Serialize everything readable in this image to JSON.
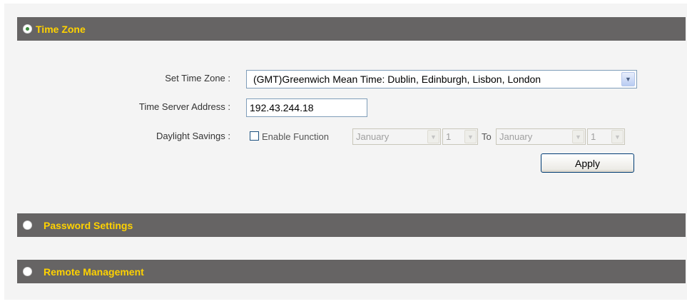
{
  "sections": {
    "time_zone": {
      "title": "Time Zone",
      "expanded": true
    },
    "password_settings": {
      "title": "Password Settings",
      "expanded": false
    },
    "remote_management": {
      "title": "Remote Management",
      "expanded": false
    }
  },
  "form": {
    "time_zone_label": "Set Time Zone :",
    "time_zone_value": "(GMT)Greenwich Mean Time: Dublin, Edinburgh, Lisbon, London",
    "time_server_label": "Time Server Address :",
    "time_server_value": "192.43.244.18",
    "daylight_label": "Daylight Savings :",
    "enable_function_label": "Enable Function",
    "enable_function_checked": false,
    "start_month": "January",
    "start_day": "1",
    "to_label": "To",
    "end_month": "January",
    "end_day": "1",
    "apply_label": "Apply"
  },
  "colors": {
    "header_bg": "#666464",
    "header_text": "#ffd200",
    "panel_bg": "#f4f4f4"
  },
  "icons": {
    "section_expanded": "radio-selected-icon",
    "section_collapsed": "radio-unselected-icon",
    "dropdown": "chevron-down-icon"
  }
}
